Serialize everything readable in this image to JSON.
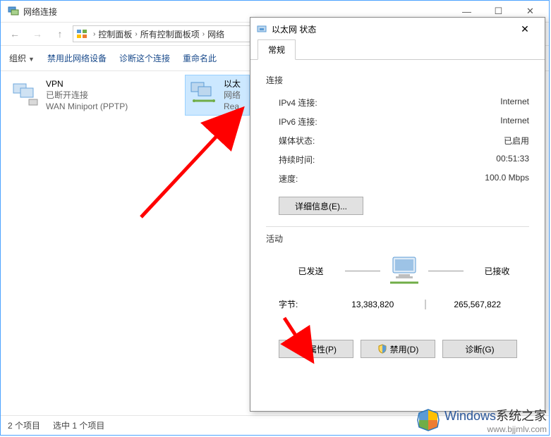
{
  "window": {
    "title": "网络连接",
    "minimize": "—",
    "maximize": "☐",
    "close": "✕"
  },
  "breadcrumbs": {
    "seg1": "控制面板",
    "seg2": "所有控制面板项",
    "seg3": "网络"
  },
  "toolbar": {
    "organize": "组织",
    "disable": "禁用此网络设备",
    "diagnose": "诊断这个连接",
    "rename": "重命名此"
  },
  "connections": {
    "vpn": {
      "name": "VPN",
      "status": "已断开连接",
      "device": "WAN Miniport (PPTP)"
    },
    "eth": {
      "name": "以太",
      "status": "网络",
      "device": "Rea"
    }
  },
  "statusbar": {
    "count": "2 个项目",
    "selected": "选中 1 个项目"
  },
  "dialog": {
    "title": "以太网 状态",
    "close": "✕",
    "tab": "常规",
    "sec_connection": "连接",
    "ipv4_k": "IPv4 连接:",
    "ipv4_v": "Internet",
    "ipv6_k": "IPv6 连接:",
    "ipv6_v": "Internet",
    "media_k": "媒体状态:",
    "media_v": "已启用",
    "duration_k": "持续时间:",
    "duration_v": "00:51:33",
    "speed_k": "速度:",
    "speed_v": "100.0 Mbps",
    "details_btn": "详细信息(E)...",
    "sec_activity": "活动",
    "sent": "已发送",
    "recv": "已接收",
    "bytes_k": "字节:",
    "bytes_sent": "13,383,820",
    "bytes_recv": "265,567,822",
    "btn_props": "属性(P)",
    "btn_disable": "禁用(D)",
    "btn_diag": "诊断(G)"
  },
  "watermark": {
    "brand": "Windows",
    "suffix": "系统之家",
    "url": "www.bjjmlv.com"
  }
}
